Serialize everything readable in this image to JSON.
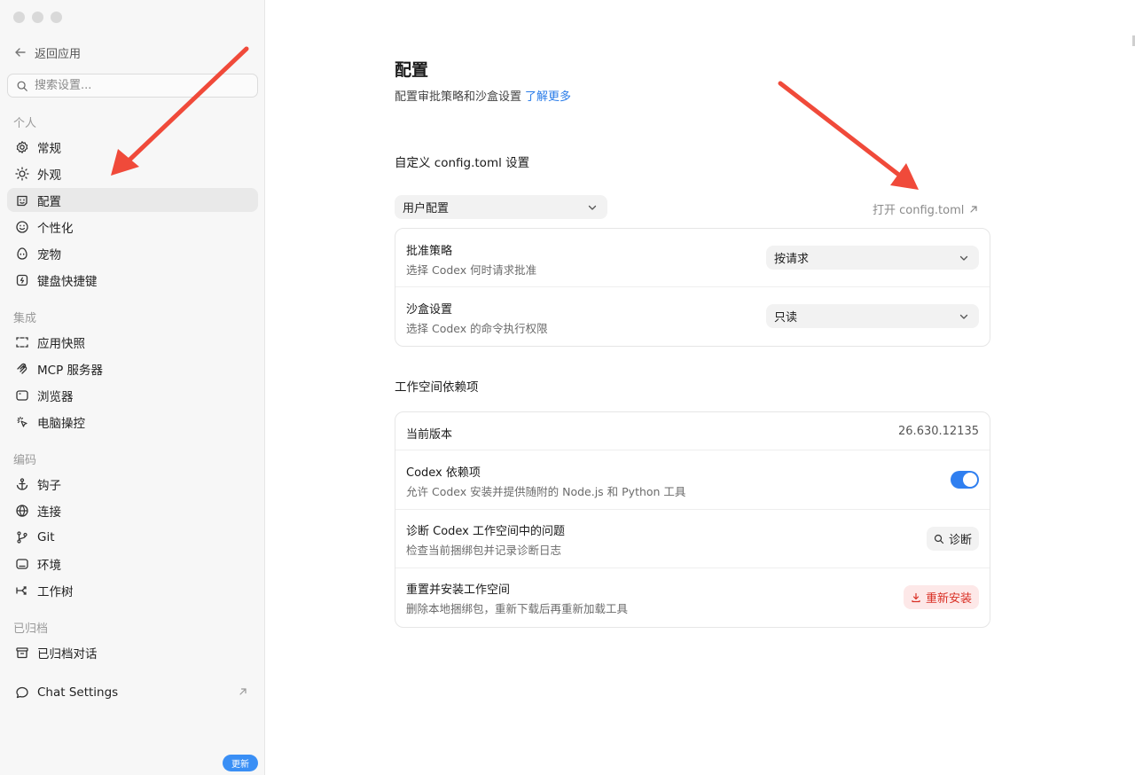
{
  "sidebar": {
    "back_label": "返回应用",
    "search_placeholder": "搜索设置...",
    "groups": {
      "personal": "个人",
      "integration": "集成",
      "coding": "编码",
      "archived": "已归档"
    },
    "items": {
      "general": "常规",
      "appearance": "外观",
      "config": "配置",
      "personalization": "个性化",
      "pet": "宠物",
      "shortcuts": "键盘快捷键",
      "snapshot": "应用快照",
      "mcp": "MCP 服务器",
      "browser": "浏览器",
      "computer": "电脑操控",
      "hooks": "钩子",
      "connections": "连接",
      "git": "Git",
      "environment": "环境",
      "worktree": "工作树",
      "archived_chats": "已归档对话",
      "chat_settings": "Chat Settings"
    },
    "update_badge": "更新"
  },
  "main": {
    "title": "配置",
    "subtitle": "配置审批策略和沙盒设置",
    "learn_more": "了解更多",
    "custom_section": "自定义 config.toml 设置",
    "profile_select": "用户配置",
    "open_config": "打开 config.toml",
    "approval": {
      "title": "批准策略",
      "desc": "选择 Codex 何时请求批准",
      "value": "按请求"
    },
    "sandbox": {
      "title": "沙盒设置",
      "desc": "选择 Codex 的命令执行权限",
      "value": "只读"
    },
    "workspace_section": "工作空间依赖项",
    "version": {
      "title": "当前版本",
      "value": "26.630.12135"
    },
    "deps": {
      "title": "Codex 依赖项",
      "desc": "允许 Codex 安装并提供随附的 Node.js 和 Python 工具",
      "enabled": true
    },
    "diagnose": {
      "title": "诊断 Codex 工作空间中的问题",
      "desc": "检查当前捆绑包并记录诊断日志",
      "button": "诊断"
    },
    "reinstall": {
      "title": "重置并安装工作空间",
      "desc": "删除本地捆绑包，重新下载后再重新加载工具",
      "button": "重新安装"
    }
  },
  "colors": {
    "accent": "#2f7ff0",
    "link": "#2b7de9",
    "danger": "#d93025",
    "annotation_arrow": "#f04a3a"
  }
}
